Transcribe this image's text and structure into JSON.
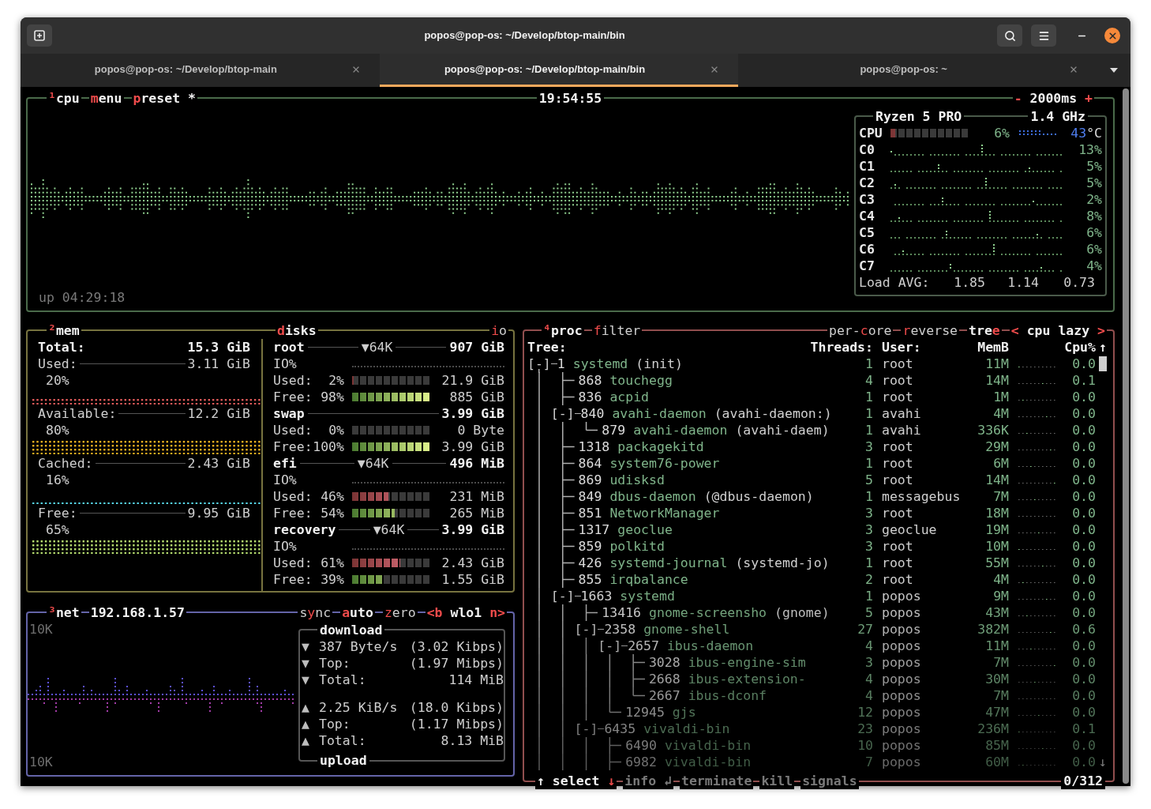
{
  "window": {
    "title": "popos@pop-os: ~/Develop/btop-main/bin"
  },
  "tabs": [
    {
      "label": "popos@pop-os: ~/Develop/btop-main",
      "selected": false
    },
    {
      "label": "popos@pop-os: ~/Develop/btop-main/bin",
      "selected": true
    },
    {
      "label": "popos@pop-os: ~",
      "selected": false
    }
  ],
  "cpu": {
    "chips_left": [
      {
        "active": true,
        "segments": [
          {
            "text": "¹",
            "hotkey": true
          },
          {
            "text": "cpu",
            "hotkey": false
          }
        ]
      },
      {
        "active": true,
        "segments": [
          {
            "text": "m",
            "hotkey": true
          },
          {
            "text": "enu",
            "hotkey": false
          }
        ]
      },
      {
        "active": true,
        "segments": [
          {
            "text": "p",
            "hotkey": true
          },
          {
            "text": "reset *",
            "hotkey": false
          }
        ]
      }
    ],
    "clock": "19:54:55",
    "chips_right": [
      {
        "active": true,
        "segments": [
          {
            "text": "-",
            "hotkey": true
          },
          {
            "text": " 2000ms ",
            "hotkey": false
          },
          {
            "text": "+",
            "hotkey": true
          }
        ]
      }
    ],
    "uptime": "up 04:29:18",
    "model": "Ryzen 5 PRO",
    "frequency": "1.4 GHz",
    "total": {
      "label": "CPU",
      "level": 0.06,
      "percent": "6%",
      "temperature": "43",
      "temperature_unit": "°C"
    },
    "cores": [
      {
        "label": "C0",
        "percent": "13%"
      },
      {
        "label": "C1",
        "percent": "5%"
      },
      {
        "label": "C2",
        "percent": "5%"
      },
      {
        "label": "C3",
        "percent": "2%"
      },
      {
        "label": "C4",
        "percent": "8%"
      },
      {
        "label": "C5",
        "percent": "6%"
      },
      {
        "label": "C6",
        "percent": "6%"
      },
      {
        "label": "C7",
        "percent": "4%"
      }
    ],
    "load": {
      "label": "Load AVG:",
      "values": [
        "1.85",
        "1.14",
        "0.73"
      ]
    }
  },
  "mem": {
    "chips": [
      {
        "active": true,
        "segments": [
          {
            "text": "²",
            "hotkey": true
          },
          {
            "text": "mem",
            "hotkey": false
          }
        ]
      }
    ],
    "total": {
      "label": "Total:",
      "value": "15.3 GiB"
    },
    "items": [
      {
        "label": "Used:",
        "value": "3.11 GiB",
        "percent": "20%",
        "color": "#e05a5a"
      },
      {
        "label": "Available:",
        "value": "12.2 GiB",
        "percent": "80%",
        "color": "#f0b020"
      },
      {
        "label": "Cached:",
        "value": "2.43 GiB",
        "percent": "16%",
        "color": "#56d6e8"
      },
      {
        "label": "Free:",
        "value": "9.95 GiB",
        "percent": "65%",
        "color": "#b8e070"
      }
    ]
  },
  "disks": {
    "chips_left": [
      {
        "active": true,
        "segments": [
          {
            "text": "d",
            "hotkey": true
          },
          {
            "text": "isks",
            "hotkey": false
          }
        ]
      }
    ],
    "chips_right": [
      {
        "active": false,
        "segments": [
          {
            "text": "i",
            "hotkey": true
          },
          {
            "text": "o",
            "hotkey": false
          }
        ]
      }
    ],
    "items": [
      {
        "name": "root",
        "io": "▼64K",
        "size": "907 GiB",
        "io_label": "IO%",
        "used": {
          "label": "Used:",
          "percent": "2%",
          "level": 0.02,
          "value": "21.9 GiB"
        },
        "free": {
          "label": "Free:",
          "percent": "98%",
          "level": 0.98,
          "value": "885 GiB"
        }
      },
      {
        "name": "swap",
        "size": "3.99 GiB",
        "used": {
          "label": "Used:",
          "percent": "0%",
          "level": 0,
          "value": "0 Byte"
        },
        "free": {
          "label": "Free:",
          "percent": "100%",
          "level": 1,
          "value": "3.99 GiB"
        }
      },
      {
        "name": "efi",
        "io": "▼64K",
        "size": "496 MiB",
        "io_label": "IO%",
        "used": {
          "label": "Used:",
          "percent": "46%",
          "level": 0.46,
          "value": "231 MiB"
        },
        "free": {
          "label": "Free:",
          "percent": "54%",
          "level": 0.54,
          "value": "265 MiB"
        }
      },
      {
        "name": "recovery",
        "io": "▼64K",
        "size": "3.99 GiB",
        "io_label": "IO%",
        "used": {
          "label": "Used:",
          "percent": "61%",
          "level": 0.61,
          "value": "2.43 GiB"
        },
        "free": {
          "label": "Free:",
          "percent": "39%",
          "level": 0.39,
          "value": "1.55 GiB"
        }
      }
    ]
  },
  "net": {
    "chips_left": [
      {
        "active": true,
        "segments": [
          {
            "text": "³",
            "hotkey": true
          },
          {
            "text": "net",
            "hotkey": false
          }
        ]
      },
      {
        "active": true,
        "segments": [
          {
            "text": "192.168.1.57",
            "hotkey": false
          }
        ]
      }
    ],
    "chips_right": [
      {
        "active": false,
        "segments": [
          {
            "text": "s",
            "hotkey": false
          },
          {
            "text": "y",
            "hotkey": true
          },
          {
            "text": "nc",
            "hotkey": false
          }
        ]
      },
      {
        "active": true,
        "segments": [
          {
            "text": "a",
            "hotkey": true
          },
          {
            "text": "uto",
            "hotkey": false
          }
        ]
      },
      {
        "active": false,
        "segments": [
          {
            "text": "z",
            "hotkey": true
          },
          {
            "text": "ero",
            "hotkey": false
          }
        ]
      },
      {
        "active": true,
        "segments": [
          {
            "text": "<b",
            "hotkey": true
          },
          {
            "text": " wlo1 ",
            "hotkey": false
          },
          {
            "text": "n>",
            "hotkey": true
          }
        ]
      }
    ],
    "scale_top": "10K",
    "scale_bottom": "10K",
    "download": {
      "title": "download",
      "rows": [
        {
          "arrow": "▼",
          "label": "387 Byte/s",
          "value": "(3.02 Kibps)"
        },
        {
          "arrow": "▼",
          "label": "Top:",
          "value": "(1.97 Mibps)"
        },
        {
          "arrow": "▼",
          "label": "Total:",
          "value": "114 MiB"
        }
      ]
    },
    "upload": {
      "title": "upload",
      "rows": [
        {
          "arrow": "▲",
          "label": "2.25 KiB/s",
          "value": "(18.0 Kibps)"
        },
        {
          "arrow": "▲",
          "label": "Top:",
          "value": "(1.17 Mibps)"
        },
        {
          "arrow": "▲",
          "label": "Total:",
          "value": "8.13 MiB"
        }
      ]
    }
  },
  "proc": {
    "chips_left": [
      {
        "active": true,
        "segments": [
          {
            "text": "⁴",
            "hotkey": true
          },
          {
            "text": "proc",
            "hotkey": false
          }
        ]
      },
      {
        "active": false,
        "segments": [
          {
            "text": "f",
            "hotkey": true
          },
          {
            "text": "ilter",
            "hotkey": false
          }
        ]
      }
    ],
    "chips_right": [
      {
        "active": false,
        "segments": [
          {
            "text": "per-",
            "hotkey": false
          },
          {
            "text": "c",
            "hotkey": true
          },
          {
            "text": "ore",
            "hotkey": false
          }
        ]
      },
      {
        "active": false,
        "segments": [
          {
            "text": "r",
            "hotkey": true
          },
          {
            "text": "everse",
            "hotkey": false
          }
        ]
      },
      {
        "active": true,
        "segments": [
          {
            "text": "tre",
            "hotkey": false
          },
          {
            "text": "e",
            "hotkey": true
          }
        ]
      },
      {
        "active": true,
        "segments": [
          {
            "text": "<",
            "hotkey": true
          },
          {
            "text": " cpu lazy ",
            "hotkey": false
          },
          {
            "text": ">",
            "hotkey": true
          }
        ]
      }
    ],
    "columns": [
      "Tree:",
      "Threads:",
      "User:",
      "MemB",
      "Cpu%"
    ],
    "scroll_up": "↑",
    "scroll_down": "↓",
    "processes": [
      {
        "toggle": "[-]",
        "pid": "1",
        "name": "systemd",
        "args": "(init)",
        "threads": "1",
        "user": "root",
        "mem": "11M",
        "cpu": "0.0",
        "last": false,
        "children": [
          {
            "pid": "868",
            "name": "touchegg",
            "threads": "4",
            "user": "root",
            "mem": "14M",
            "cpu": "0.1",
            "last": false
          },
          {
            "pid": "836",
            "name": "acpid",
            "threads": "1",
            "user": "root",
            "mem": "1M",
            "cpu": "0.0",
            "last": false
          },
          {
            "toggle": "[-]",
            "pid": "840",
            "name": "avahi-daemon",
            "args": "(avahi-daemon:)",
            "threads": "1",
            "user": "avahi",
            "mem": "4M",
            "cpu": "0.0",
            "last": false,
            "children": [
              {
                "pid": "879",
                "name": "avahi-daemon",
                "args": "(avahi-daem)",
                "threads": "1",
                "user": "avahi",
                "mem": "336K",
                "cpu": "0.0",
                "last": true
              }
            ]
          },
          {
            "pid": "1318",
            "name": "packagekitd",
            "threads": "3",
            "user": "root",
            "mem": "29M",
            "cpu": "0.0",
            "last": false
          },
          {
            "pid": "864",
            "name": "system76-power",
            "threads": "1",
            "user": "root",
            "mem": "6M",
            "cpu": "0.0",
            "last": false
          },
          {
            "pid": "869",
            "name": "udisksd",
            "threads": "5",
            "user": "root",
            "mem": "14M",
            "cpu": "0.0",
            "last": false
          },
          {
            "pid": "849",
            "name": "dbus-daemon",
            "args": "(@dbus-daemon)",
            "threads": "1",
            "user": "messagebus",
            "mem": "7M",
            "cpu": "0.0",
            "last": false
          },
          {
            "pid": "851",
            "name": "NetworkManager",
            "threads": "3",
            "user": "root",
            "mem": "18M",
            "cpu": "0.0",
            "last": false
          },
          {
            "pid": "1317",
            "name": "geoclue",
            "threads": "3",
            "user": "geoclue",
            "mem": "19M",
            "cpu": "0.0",
            "last": false
          },
          {
            "pid": "859",
            "name": "polkitd",
            "threads": "3",
            "user": "root",
            "mem": "10M",
            "cpu": "0.0",
            "last": false
          },
          {
            "pid": "426",
            "name": "systemd-journal",
            "args": "(systemd-jo)",
            "threads": "1",
            "user": "root",
            "mem": "55M",
            "cpu": "0.0",
            "last": false
          },
          {
            "pid": "855",
            "name": "irqbalance",
            "threads": "2",
            "user": "root",
            "mem": "4M",
            "cpu": "0.0",
            "last": false
          },
          {
            "toggle": "[-]",
            "pid": "1663",
            "name": "systemd",
            "threads": "1",
            "user": "popos",
            "mem": "9M",
            "cpu": "0.0",
            "last": false,
            "children": [
              {
                "pid": "13416",
                "name": "gnome-screensho",
                "args": "(gnome)",
                "threads": "5",
                "user": "popos",
                "mem": "43M",
                "cpu": "0.0",
                "last": false
              },
              {
                "toggle": "[-]",
                "pid": "2358",
                "name": "gnome-shell",
                "threads": "27",
                "user": "popos",
                "mem": "382M",
                "cpu": "0.6",
                "last": false,
                "children": [
                  {
                    "toggle": "[-]",
                    "pid": "2657",
                    "name": "ibus-daemon",
                    "threads": "4",
                    "user": "popos",
                    "mem": "11M",
                    "cpu": "0.0",
                    "last": false,
                    "children": [
                      {
                        "pid": "3028",
                        "name": "ibus-engine-sim",
                        "threads": "3",
                        "user": "popos",
                        "mem": "7M",
                        "cpu": "0.0",
                        "last": false
                      },
                      {
                        "pid": "2668",
                        "name": "ibus-extension-",
                        "threads": "4",
                        "user": "popos",
                        "mem": "30M",
                        "cpu": "0.0",
                        "last": false
                      },
                      {
                        "pid": "2667",
                        "name": "ibus-dconf",
                        "threads": "4",
                        "user": "popos",
                        "mem": "7M",
                        "cpu": "0.0",
                        "last": true
                      }
                    ]
                  },
                  {
                    "pid": "12945",
                    "name": "gjs",
                    "threads": "12",
                    "user": "popos",
                    "mem": "47M",
                    "cpu": "0.0",
                    "last": true
                  }
                ]
              },
              {
                "toggle": "[-]",
                "pid": "6435",
                "name": "vivaldi-bin",
                "threads": "23",
                "user": "popos",
                "mem": "236M",
                "cpu": "0.1",
                "last": false,
                "children": [
                  {
                    "pid": "6490",
                    "name": "vivaldi-bin",
                    "threads": "10",
                    "user": "popos",
                    "mem": "85M",
                    "cpu": "0.0",
                    "last": false
                  },
                  {
                    "pid": "6982",
                    "name": "vivaldi-bin",
                    "threads": "7",
                    "user": "popos",
                    "mem": "60M",
                    "cpu": "0.0",
                    "last": false
                  }
                ]
              }
            ]
          }
        ]
      }
    ],
    "footer": [
      {
        "active": true,
        "segments": [
          {
            "text": "↑",
            "hotkey": false
          },
          {
            "text": " select ",
            "hotkey": false
          },
          {
            "text": "↓",
            "hotkey": true
          }
        ]
      },
      {
        "active": false,
        "segments": [
          {
            "text": "info ",
            "hotkey": false
          },
          {
            "text": "↲",
            "hotkey": false
          }
        ]
      },
      {
        "active": false,
        "segments": [
          {
            "text": "terminate",
            "hotkey": false
          }
        ]
      },
      {
        "active": false,
        "segments": [
          {
            "text": "kill",
            "hotkey": false
          }
        ]
      },
      {
        "active": false,
        "segments": [
          {
            "text": "signals",
            "hotkey": false
          }
        ]
      }
    ],
    "count": "0/312"
  }
}
